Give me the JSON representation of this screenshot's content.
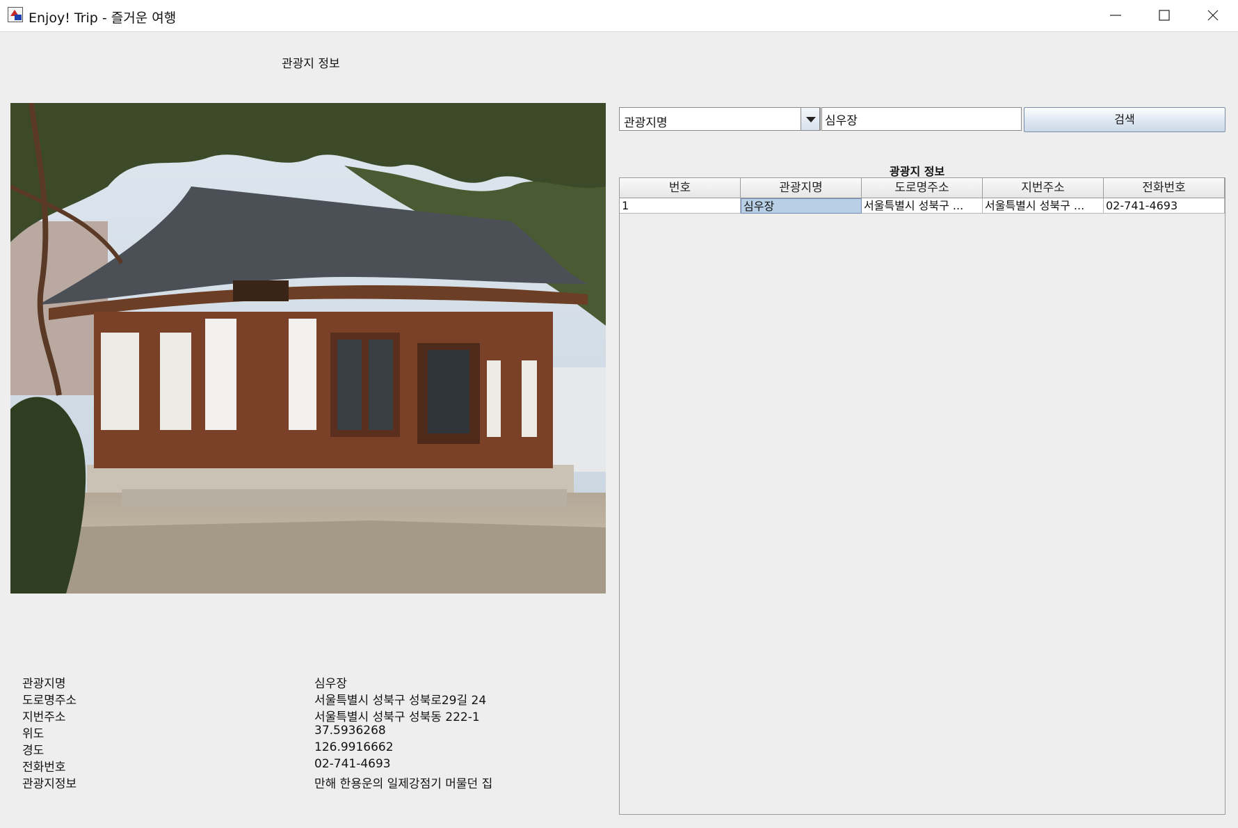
{
  "window": {
    "title": "Enjoy! Trip - 즐거운 여행",
    "minimize_icon": "minimize-icon",
    "maximize_icon": "maximize-icon",
    "close_icon": "close-icon"
  },
  "left_panel": {
    "title": "관광지 정보",
    "photo_alt": "",
    "info_rows": [
      {
        "label": "관광지명",
        "value": "심우장"
      },
      {
        "label": "도로명주소",
        "value": "서울특별시 성북구 성북로29길 24"
      },
      {
        "label": "지번주소",
        "value": "서울특별시 성북구 성북동 222-1"
      },
      {
        "label": "위도",
        "value": "37.5936268"
      },
      {
        "label": "경도",
        "value": "126.9916662"
      },
      {
        "label": "전화번호",
        "value": "02-741-4693"
      },
      {
        "label": "관광지정보",
        "value": "만해 한용운의 일제강점기 머물던 집"
      }
    ]
  },
  "search": {
    "select_value": "관광지명",
    "input_value": "심우장",
    "button_label": "검색"
  },
  "table": {
    "title": "광광지 정보",
    "columns": [
      "번호",
      "관광지명",
      "도로명주소",
      "지번주소",
      "전화번호"
    ],
    "rows": [
      [
        "1",
        "심우장",
        "서울특별시 성북구 ...",
        "서울특별시 성북구 ...",
        "02-741-4693"
      ]
    ],
    "selected_cell": {
      "row": 0,
      "col": 1
    }
  },
  "colors": {
    "window_bg": "#eeeeee",
    "selected_cell": "#b8cfe5",
    "button_gradient_bottom": "#cdd9e8"
  }
}
